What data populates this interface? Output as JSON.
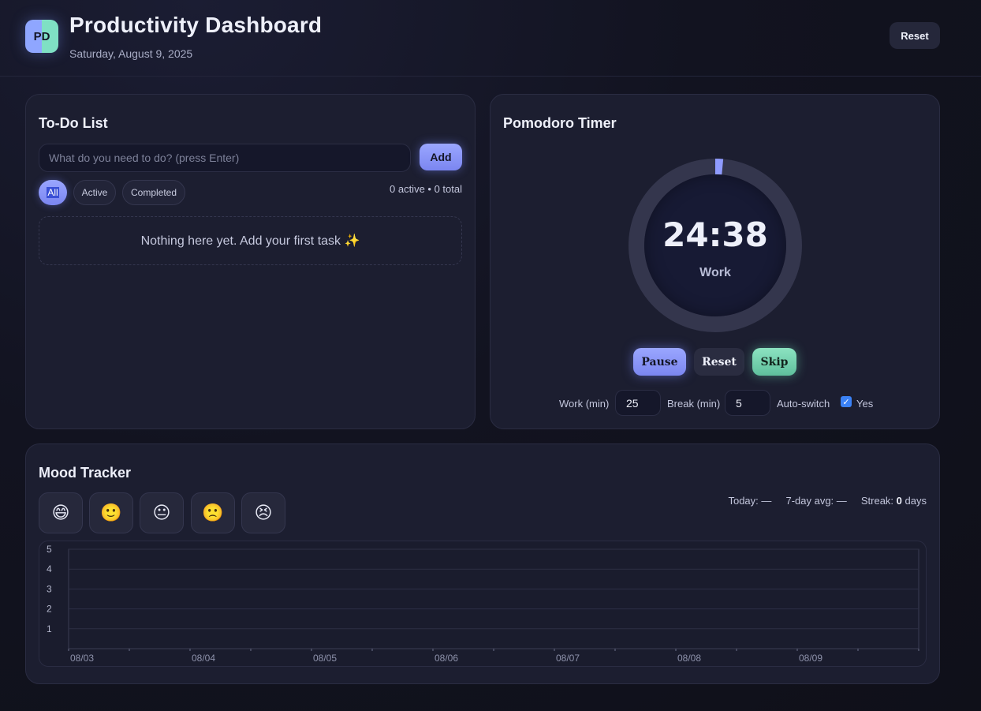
{
  "header": {
    "logo_text": "PD",
    "title": "Productivity Dashboard",
    "date": "Saturday, August 9, 2025",
    "reset_label": "Reset"
  },
  "todo": {
    "title": "To-Do List",
    "input_placeholder": "What do you need to do? (press Enter)",
    "add_label": "Add",
    "filters": [
      "All",
      "Active",
      "Completed"
    ],
    "active_filter": "All",
    "stats": "0 active • 0 total",
    "empty_text": "Nothing here yet. Add your first task ✨"
  },
  "pomodoro": {
    "title": "Pomodoro Timer",
    "time": "24:38",
    "mode": "Work",
    "progress": 0.0147,
    "pause_label": "Pause",
    "reset_label": "Reset",
    "skip_label": "Skip",
    "work_label": "Work (min)",
    "work_value": "25",
    "break_label": "Break (min)",
    "break_value": "5",
    "autoswitch_label": "Auto-switch",
    "autoswitch_checked": true,
    "autoswitch_option": "Yes"
  },
  "mood": {
    "title": "Mood Tracker",
    "emojis": [
      "😄",
      "🙂",
      "😐",
      "🙁",
      "😣"
    ],
    "today_label": "Today:",
    "today_value": "—",
    "avg_label": "7-day avg:",
    "avg_value": "—",
    "streak_label": "Streak:",
    "streak_value": "0",
    "streak_unit": "days"
  },
  "chart_data": {
    "type": "line",
    "x": [
      "08/03",
      "08/04",
      "08/05",
      "08/06",
      "08/07",
      "08/08",
      "08/09"
    ],
    "y_ticks": [
      1,
      2,
      3,
      4,
      5
    ],
    "ylim": [
      0,
      5
    ],
    "series": [],
    "grid": true
  },
  "colors": {
    "accent": "#8f9bff",
    "accent_green": "#7fdcb8",
    "card_bg": "#1c1e30",
    "page_bg": "#121320"
  }
}
